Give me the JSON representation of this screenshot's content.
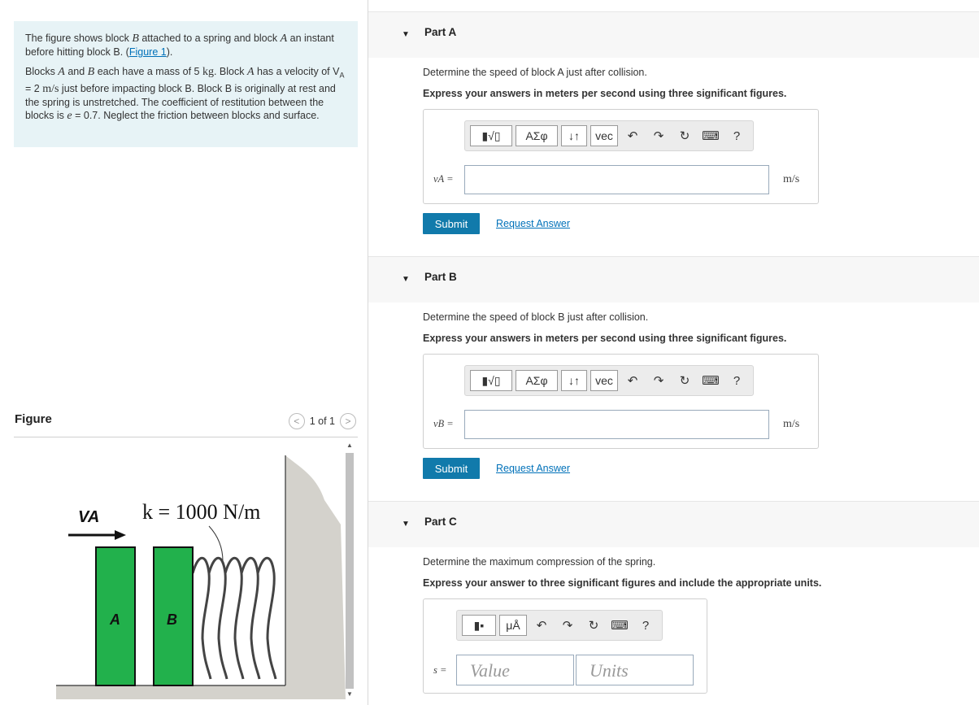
{
  "problem": {
    "p1_a": "The figure shows block ",
    "p1_b": "B",
    "p1_c": " attached to a spring and block ",
    "p1_d": "A",
    "p1_e": " an instant before hitting block B. (",
    "p1_link": "Figure 1",
    "p1_f": ").",
    "p2_a": "Blocks ",
    "p2_b": "A",
    "p2_c": " and ",
    "p2_d": "B",
    "p2_e": " each have a mass of 5 ",
    "p2_kg": "kg",
    "p2_f": ". Block ",
    "p2_g": "A",
    "p2_h": " has a velocity of V",
    "p2_sub": "A",
    "p2_i": " = 2 ",
    "p2_ms": "m/s",
    "p2_j": "  just before impacting block B. Block B is originally at rest and the spring is unstretched. The coefficient of restitution between the blocks is ",
    "p2_e_sym": "e",
    "p2_k": " = 0.7. Neglect the friction between blocks and surface."
  },
  "figure": {
    "title": "Figure",
    "pager": "1 of 1",
    "va_label": "VA",
    "k_label": "k = 1000 N/m",
    "block_a": "A",
    "block_b": "B",
    "block_color": "#22b14c"
  },
  "parts": [
    {
      "title": "Part A",
      "question": "Determine the speed of block A just after collision.",
      "instruction": "Express your answers in meters per second using three significant figures.",
      "var": "vA =",
      "unit": "m/s",
      "submit": "Submit",
      "request": "Request Answer"
    },
    {
      "title": "Part B",
      "question": "Determine the speed of block B just after collision.",
      "instruction": "Express your answers in meters per second using three significant figures.",
      "var": "vB =",
      "unit": "m/s",
      "submit": "Submit",
      "request": "Request Answer"
    },
    {
      "title": "Part C",
      "question": "Determine the maximum compression of the spring.",
      "instruction": "Express your answer to three significant figures and include the appropriate units.",
      "var": "s =",
      "value_placeholder": "Value",
      "units_placeholder": "Units"
    }
  ],
  "toolbar": {
    "greek": "ΑΣφ",
    "sort": "↓↑",
    "vec": "vec",
    "undo": "↶",
    "redo": "↷",
    "reset": "↻",
    "help": "?",
    "micro": "μÅ"
  },
  "colors": {
    "accent": "#117aab",
    "link": "#0071b9",
    "problem_bg": "#e7f3f6"
  }
}
